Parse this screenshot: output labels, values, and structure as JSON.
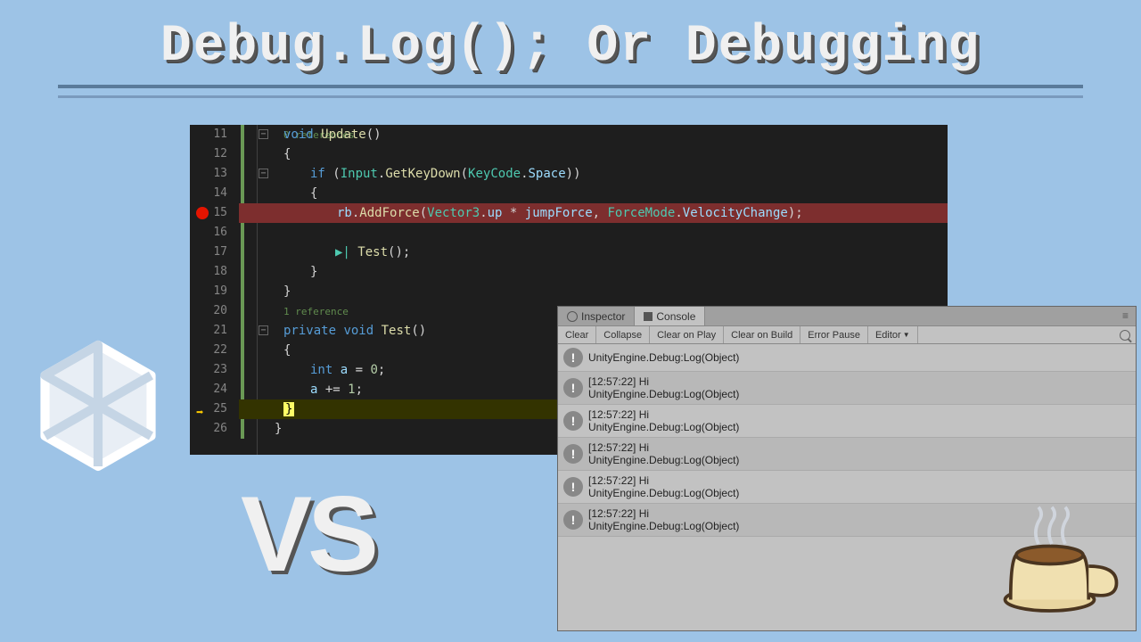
{
  "title": "Debug.Log(); Or Debugging",
  "vs": "VS",
  "editor": {
    "lines": [
      {
        "n": 11,
        "ref": "0 references"
      },
      {
        "n": 12
      },
      {
        "n": 13
      },
      {
        "n": 14
      },
      {
        "n": 15,
        "bp": true
      },
      {
        "n": 16
      },
      {
        "n": 17
      },
      {
        "n": 18
      },
      {
        "n": 19
      },
      {
        "n": 20
      },
      {
        "n": 21,
        "ref": "1 reference"
      },
      {
        "n": 22
      },
      {
        "n": 23
      },
      {
        "n": 24
      },
      {
        "n": 25,
        "cur": true
      },
      {
        "n": 26
      }
    ],
    "code": {
      "l11_void": "void",
      "l11_fn": "Update",
      "l11_p": "()",
      "l12": "{",
      "l13_if": "if",
      "l13_p1": " (",
      "l13_cls": "Input",
      "l13_dot": ".",
      "l13_fn": "GetKeyDown",
      "l13_p2": "(",
      "l13_cls2": "KeyCode",
      "l13_dot2": ".",
      "l13_var": "Space",
      "l13_p3": "))",
      "l14": "{",
      "l15_var": "rb",
      "l15_dot": ".",
      "l15_fn": "AddForce",
      "l15_p1": "(",
      "l15_cls": "Vector3",
      "l15_dot2": ".",
      "l15_prop": "up",
      "l15_op": " * ",
      "l15_var2": "jumpForce",
      "l15_c": ", ",
      "l15_cls2": "ForceMode",
      "l15_dot3": ".",
      "l15_prop2": "VelocityChange",
      "l15_p2": ");",
      "l16": "",
      "l17_play": "▶|",
      "l17_fn": "Test",
      "l17_p": "();",
      "l18": "}",
      "l19": "}",
      "l21_priv": "private",
      "l21_void": " void ",
      "l21_fn": "Test",
      "l21_p": "()",
      "l22": "{",
      "l23_int": "int",
      "l23_sp": " ",
      "l23_var": "a",
      "l23_eq": " = ",
      "l23_num": "0",
      "l23_sc": ";",
      "l24_var": "a",
      "l24_op": " += ",
      "l24_num": "1",
      "l24_sc": ";",
      "l25": "}",
      "l26": "}"
    }
  },
  "console": {
    "tabs": {
      "inspector": "Inspector",
      "console": "Console"
    },
    "toolbar": {
      "clear": "Clear",
      "collapse": "Collapse",
      "clearPlay": "Clear on Play",
      "clearBuild": "Clear on Build",
      "errorPause": "Error Pause",
      "editor": "Editor"
    },
    "entries": [
      {
        "time": "",
        "msg": "UnityEngine.Debug:Log(Object)"
      },
      {
        "time": "[12:57:22] Hi",
        "msg": "UnityEngine.Debug:Log(Object)"
      },
      {
        "time": "[12:57:22] Hi",
        "msg": "UnityEngine.Debug:Log(Object)"
      },
      {
        "time": "[12:57:22] Hi",
        "msg": "UnityEngine.Debug:Log(Object)"
      },
      {
        "time": "[12:57:22] Hi",
        "msg": "UnityEngine.Debug:Log(Object)"
      },
      {
        "time": "[12:57:22] Hi",
        "msg": "UnityEngine.Debug:Log(Object)"
      }
    ]
  }
}
